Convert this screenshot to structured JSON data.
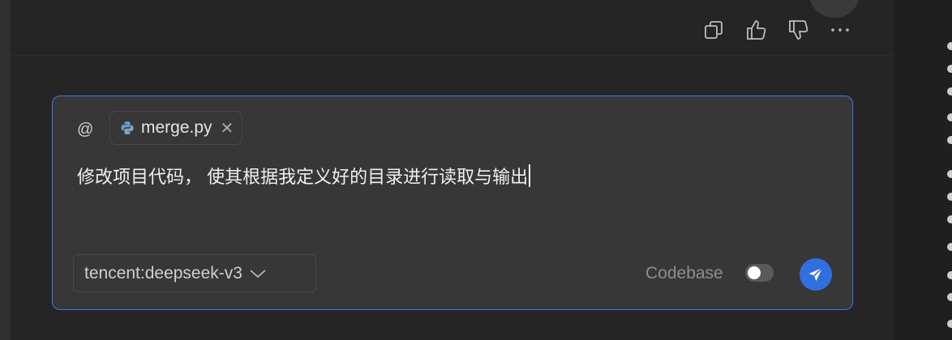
{
  "message_actions": {
    "copy_icon": "copy-icon",
    "like_icon": "thumbs-up-icon",
    "dislike_icon": "thumbs-down-icon",
    "more_icon": "more-icon"
  },
  "composer": {
    "at_symbol": "@",
    "attached_file": {
      "name": "merge.py",
      "icon": "python-icon",
      "remove_symbol": "✕"
    },
    "input_text": "修改项目代码， 使其根据我定义好的目录进行读取与输出",
    "model": "tencent:deepseek-v3",
    "codebase_label": "Codebase",
    "codebase_enabled": false,
    "send_icon": "send-icon",
    "accent_color": "#3b7ae8"
  }
}
